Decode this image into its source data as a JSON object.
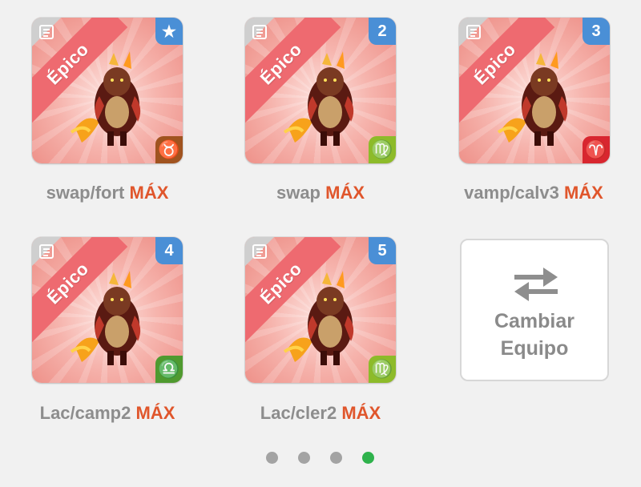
{
  "cards": [
    {
      "rarity": "Épico",
      "badge_type": "star",
      "badge_text": "★",
      "badge_color": "#4a8fd6",
      "zodiac_icon": "taurus-icon",
      "zodiac_glyph": "♉",
      "zodiac_color": "#a0531f",
      "name": "swap/fort",
      "max_label": "MÁX"
    },
    {
      "rarity": "Épico",
      "badge_type": "number",
      "badge_text": "2",
      "badge_color": "#4a8fd6",
      "zodiac_icon": "virgo-icon",
      "zodiac_glyph": "♍",
      "zodiac_color": "#8dbb2a",
      "name": "swap",
      "max_label": "MÁX"
    },
    {
      "rarity": "Épico",
      "badge_type": "number",
      "badge_text": "3",
      "badge_color": "#4a8fd6",
      "zodiac_icon": "aries-icon",
      "zodiac_glyph": "♈",
      "zodiac_color": "#d8262f",
      "name": "vamp/calv3",
      "max_label": "MÁX"
    },
    {
      "rarity": "Épico",
      "badge_type": "number",
      "badge_text": "4",
      "badge_color": "#4a8fd6",
      "zodiac_icon": "libra-icon",
      "zodiac_glyph": "♎",
      "zodiac_color": "#4f9a2f",
      "name": "Lac/camp2",
      "max_label": "MÁX"
    },
    {
      "rarity": "Épico",
      "badge_type": "number",
      "badge_text": "5",
      "badge_color": "#4a8fd6",
      "zodiac_icon": "virgo-icon",
      "zodiac_glyph": "♍",
      "zodiac_color": "#8dbb2a",
      "name": "Lac/cler2",
      "max_label": "MÁX"
    }
  ],
  "swap_button": {
    "line1": "Cambiar",
    "line2": "Equipo",
    "icon": "swap-arrows-icon"
  },
  "pagination": {
    "pages": 4,
    "active_index": 3,
    "active_color": "#2fb24c",
    "inactive_color": "#a3a3a3"
  }
}
